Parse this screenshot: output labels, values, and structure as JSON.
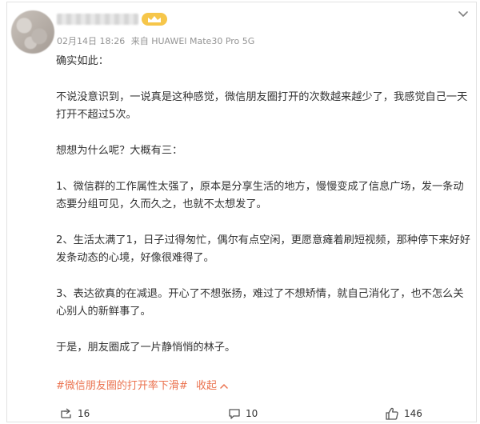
{
  "post": {
    "username_blurred": "",
    "badge_label": "",
    "date": "02月14日 18:26",
    "source": "来自 HUAWEI Mate30 Pro 5G",
    "paragraphs": [
      "确实如此：",
      "不说没意识到，一说真是这种感觉，微信朋友圈打开的次数越来越少了，我感觉自己一天打开不超过5次。",
      "想想为什么呢？大概有三：",
      "1、微信群的工作属性太强了，原本是分享生活的地方，慢慢变成了信息广场，发一条动态要分组可见，久而久之，也就不太想发了。",
      "2、生活太满了1，日子过得匆忙，偶尔有点空闲，更愿意瘫着刷短视频，那种停下来好好发条动态的心境，好像很难得了。",
      "3、表达欲真的在减退。开心了不想张扬，难过了不想矫情，就自己消化了，也不怎么关心别人的新鲜事了。",
      "于是，朋友圈成了一片静悄悄的林子。"
    ],
    "topic": "#微信朋友圈的打开率下滑#",
    "collapse_label": "收起",
    "collapse_icon": "chevron-up-icon",
    "actions": {
      "share_count": "16",
      "comment_count": "10",
      "like_count": "146"
    }
  },
  "colors": {
    "topic": "#eb7350",
    "meta": "#939393",
    "text": "#333333",
    "badge": "#f6c64a"
  }
}
